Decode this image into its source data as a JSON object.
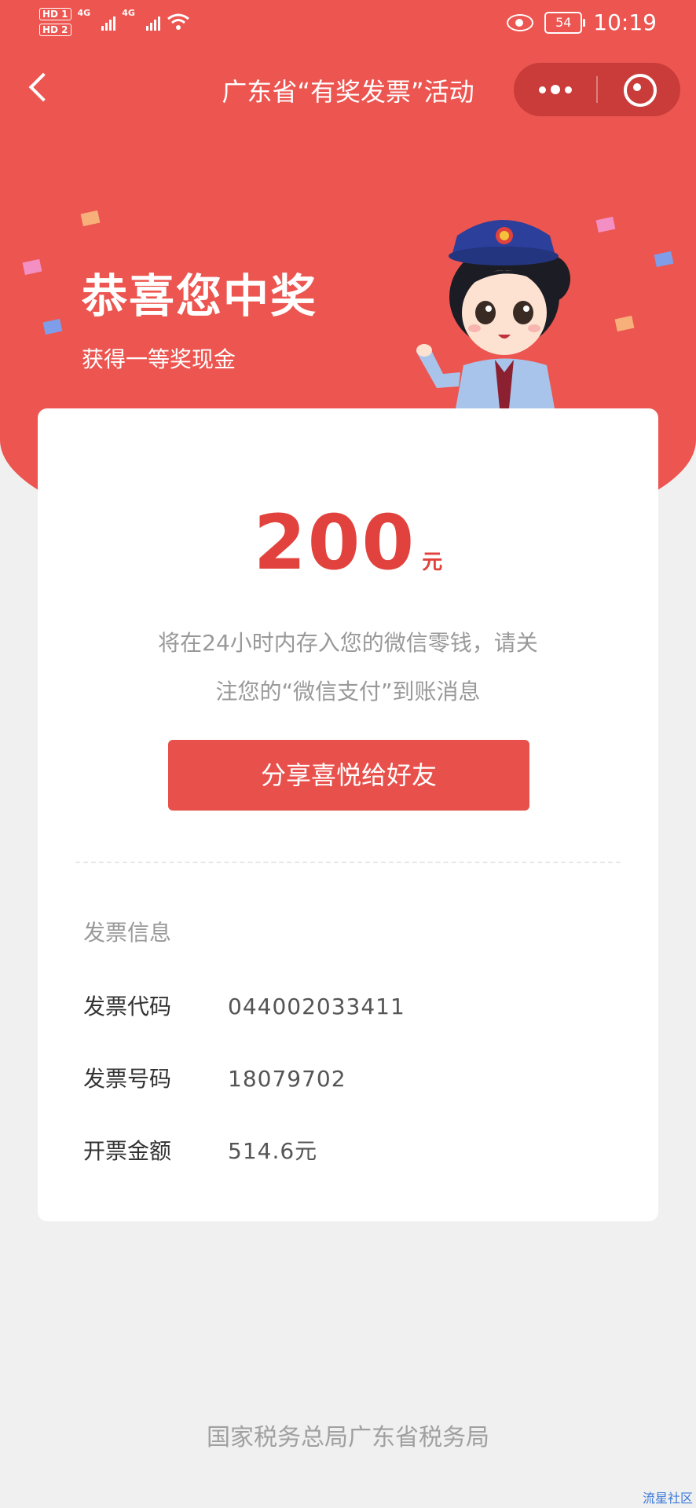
{
  "status_bar": {
    "hd1": "HD 1",
    "hd2": "HD 2",
    "net1": "4G",
    "net2": "4G",
    "battery": "54",
    "time": "10:19"
  },
  "nav": {
    "title": "广东省“有奖发票”活动"
  },
  "banner": {
    "headline": "恭喜您中奖",
    "subheadline": "获得一等奖现金"
  },
  "prize": {
    "amount": "200",
    "unit": "元",
    "notice_line1": "将在24小时内存入您的微信零钱，请关",
    "notice_line2": "注您的“微信支付”到账消息",
    "share_button": "分享喜悦给好友"
  },
  "invoice": {
    "section_title": "发票信息",
    "rows": [
      {
        "label": "发票代码",
        "value": "044002033411"
      },
      {
        "label": "发票号码",
        "value": "18079702"
      },
      {
        "label": "开票金额",
        "value": "514.6元"
      }
    ]
  },
  "footer": "国家税务总局广东省税务局",
  "watermark": "流星社区",
  "colors": {
    "primary_red": "#ec5550",
    "amount_red": "#e2423d",
    "button_red": "#e8504b",
    "page_bg": "#f0f0f0"
  }
}
